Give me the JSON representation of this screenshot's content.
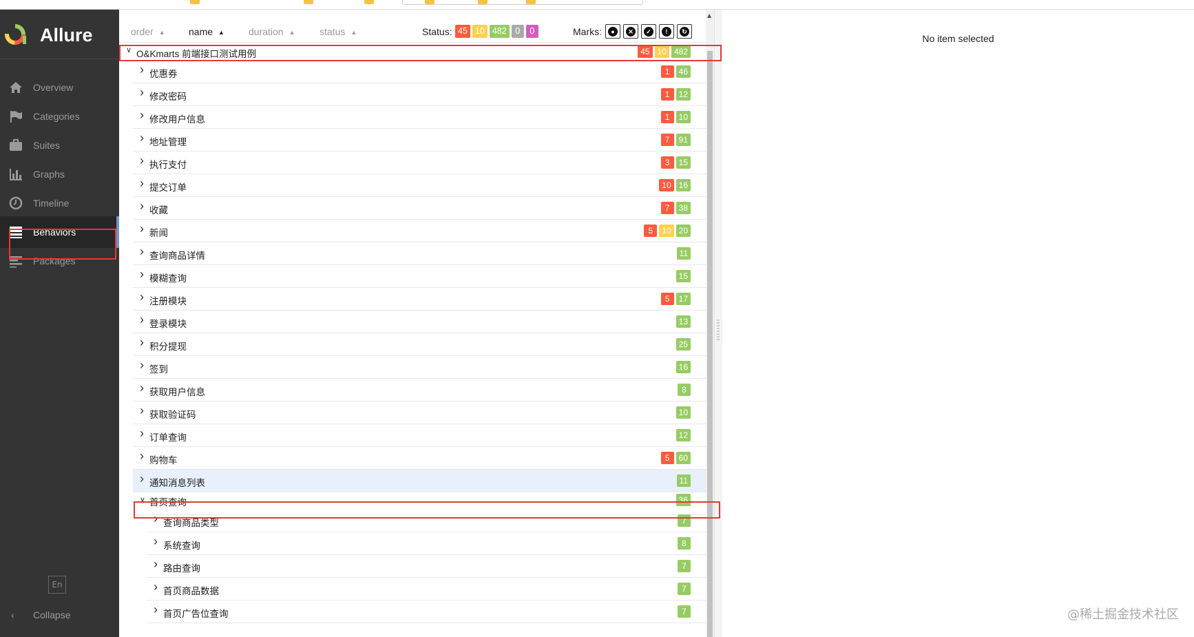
{
  "app": {
    "title": "Allure",
    "colors": {
      "sidebar_bg": "#343434",
      "accent": "#6c94c6",
      "failed": "#fd5a3e",
      "broken": "#ffd050",
      "passed": "#97cc64",
      "skipped": "#aaaaaa",
      "unknown": "#d35ebe"
    }
  },
  "sidebar": {
    "items": [
      {
        "label": "Overview",
        "icon": "home-icon"
      },
      {
        "label": "Categories",
        "icon": "flag-icon"
      },
      {
        "label": "Suites",
        "icon": "briefcase-icon"
      },
      {
        "label": "Graphs",
        "icon": "bar-chart-icon"
      },
      {
        "label": "Timeline",
        "icon": "clock-icon"
      },
      {
        "label": "Behaviors",
        "icon": "list-icon",
        "active": true
      },
      {
        "label": "Packages",
        "icon": "align-left-icon"
      }
    ],
    "language": "En",
    "collapse_label": "Collapse"
  },
  "toolbar": {
    "sorters": [
      {
        "label": "order"
      },
      {
        "label": "name",
        "active": true
      },
      {
        "label": "duration"
      },
      {
        "label": "status"
      }
    ],
    "status_label": "Status:",
    "status_counts": [
      {
        "value": "45",
        "kind": "failed"
      },
      {
        "value": "10",
        "kind": "broken"
      },
      {
        "value": "482",
        "kind": "passed"
      },
      {
        "value": "0",
        "kind": "skipped"
      },
      {
        "value": "0",
        "kind": "unknown"
      }
    ],
    "marks_label": "Marks:",
    "marks": [
      "bomb-icon",
      "times-circle-icon",
      "check-circle-icon",
      "exclamation-circle-icon",
      "refresh-icon"
    ]
  },
  "tree": {
    "root": {
      "label": "O&Kmarts 前端接口测试用例",
      "counts": [
        "45",
        "10",
        "482"
      ],
      "expanded": true
    },
    "features": [
      {
        "label": "优惠券",
        "failed": "1",
        "broken": "",
        "passed": "46"
      },
      {
        "label": "修改密码",
        "failed": "1",
        "broken": "",
        "passed": "12"
      },
      {
        "label": "修改用户信息",
        "failed": "1",
        "broken": "",
        "passed": "10"
      },
      {
        "label": "地址管理",
        "failed": "7",
        "broken": "",
        "passed": "91"
      },
      {
        "label": "执行支付",
        "failed": "3",
        "broken": "",
        "passed": "15"
      },
      {
        "label": "提交订单",
        "failed": "10",
        "broken": "",
        "passed": "16"
      },
      {
        "label": "收藏",
        "failed": "7",
        "broken": "",
        "passed": "38"
      },
      {
        "label": "新闻",
        "failed": "5",
        "broken": "10",
        "passed": "20"
      },
      {
        "label": "查询商品详情",
        "failed": "",
        "broken": "",
        "passed": "11"
      },
      {
        "label": "模糊查询",
        "failed": "",
        "broken": "",
        "passed": "15"
      },
      {
        "label": "注册模块",
        "failed": "5",
        "broken": "",
        "passed": "17"
      },
      {
        "label": "登录模块",
        "failed": "",
        "broken": "",
        "passed": "13"
      },
      {
        "label": "积分提现",
        "failed": "",
        "broken": "",
        "passed": "25"
      },
      {
        "label": "签到",
        "failed": "",
        "broken": "",
        "passed": "16"
      },
      {
        "label": "获取用户信息",
        "failed": "",
        "broken": "",
        "passed": "8"
      },
      {
        "label": "获取验证码",
        "failed": "",
        "broken": "",
        "passed": "10"
      },
      {
        "label": "订单查询",
        "failed": "",
        "broken": "",
        "passed": "12"
      },
      {
        "label": "购物车",
        "failed": "5",
        "broken": "",
        "passed": "60"
      },
      {
        "label": "通知消息列表",
        "failed": "",
        "broken": "",
        "passed": "11",
        "hover": true
      },
      {
        "label": "首页查询",
        "failed": "",
        "broken": "",
        "passed": "36",
        "expanded": true
      }
    ],
    "stories": [
      {
        "label": "查询商品类型",
        "passed": "7"
      },
      {
        "label": "系统查询",
        "passed": "8"
      },
      {
        "label": "路由查询",
        "passed": "7"
      },
      {
        "label": "首页商品数据",
        "passed": "7"
      },
      {
        "label": "首页广告位查询",
        "passed": "7"
      }
    ]
  },
  "detail": {
    "empty_text": "No item selected"
  },
  "watermark": "@稀土掘金技术社区"
}
